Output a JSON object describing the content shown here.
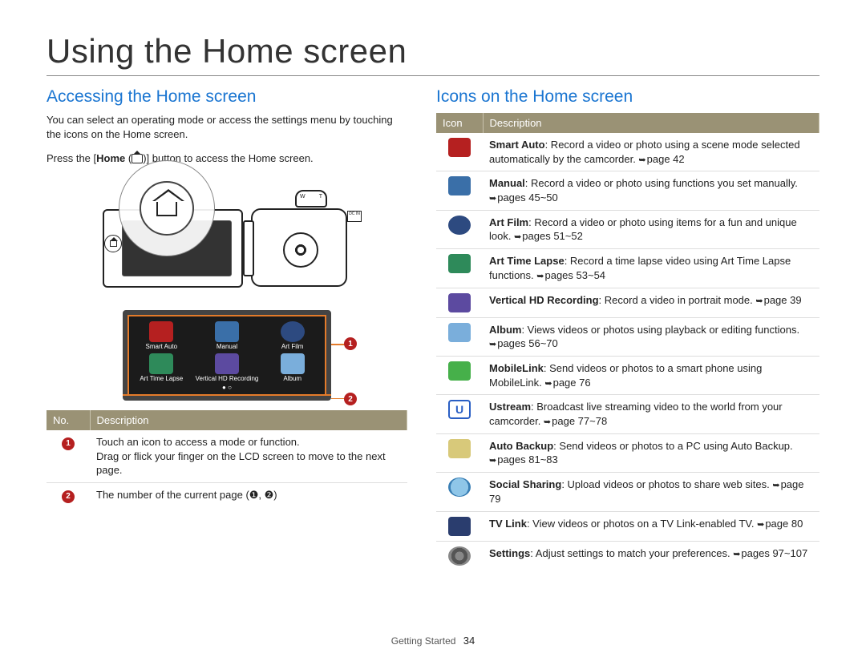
{
  "page_title": "Using the Home screen",
  "footer": {
    "section": "Getting Started",
    "page": "34"
  },
  "left": {
    "heading": "Accessing the Home screen",
    "intro": "You can select an operating mode or access the settings menu by touching the icons on the Home screen.",
    "press_pre": "Press the [",
    "press_home": "Home",
    "press_post": " (      )] button to access the Home screen.",
    "dc_label": "DC IN",
    "zoom_w": "W",
    "zoom_t": "T",
    "hs_icons": [
      {
        "label": "Smart Auto",
        "cls": "smart"
      },
      {
        "label": "Manual",
        "cls": "manual"
      },
      {
        "label": "Art Film",
        "cls": "artfilm"
      },
      {
        "label": "Art Time Lapse",
        "cls": "artlapse"
      },
      {
        "label": "Vertical HD Recording",
        "cls": "vertical"
      },
      {
        "label": "Album",
        "cls": "album"
      }
    ],
    "table": {
      "headers": [
        "No.",
        "Description"
      ],
      "rows": [
        {
          "num": "1",
          "desc": "Touch an icon to access a mode or function.\nDrag or flick your finger on the LCD screen to move to the next page."
        },
        {
          "num": "2",
          "desc": "The number of the current page (❶, ❷)"
        }
      ]
    }
  },
  "right": {
    "heading": "Icons on the Home screen",
    "headers": [
      "Icon",
      "Description"
    ],
    "rows": [
      {
        "icon": "smart",
        "u": "",
        "title": "Smart Auto",
        "body": ": Record a video or photo using a scene mode selected automatically by the camcorder. ",
        "ref": "page 42"
      },
      {
        "icon": "manual",
        "u": "",
        "title": "Manual",
        "body": ": Record a video or photo using functions you set manually. ",
        "ref": "pages 45~50"
      },
      {
        "icon": "artfilm",
        "u": "",
        "title": "Art Film",
        "body": ": Record a video or photo using items for a fun and unique look. ",
        "ref": "pages 51~52"
      },
      {
        "icon": "artlapse",
        "u": "",
        "title": "Art Time Lapse",
        "body": ": Record a time lapse video using Art Time Lapse functions. ",
        "ref": "pages 53~54"
      },
      {
        "icon": "vertical",
        "u": "",
        "title": "Vertical HD Recording",
        "body": ": Record a video in portrait mode. ",
        "ref": "page 39"
      },
      {
        "icon": "album",
        "u": "",
        "title": "Album",
        "body": ": Views videos or photos using playback or editing functions. ",
        "ref": "pages 56~70"
      },
      {
        "icon": "mobilelink",
        "u": "",
        "title": "MobileLink",
        "body": ": Send videos or photos to a smart phone using MobileLink. ",
        "ref": "page 76"
      },
      {
        "icon": "ustream",
        "u": "U",
        "title": "Ustream",
        "body": ": Broadcast live streaming video to the world from your camcorder. ",
        "ref": "page 77~78"
      },
      {
        "icon": "autobackup",
        "u": "",
        "title": "Auto Backup",
        "body": ": Send videos or photos to a PC using Auto Backup. ",
        "ref": "pages 81~83"
      },
      {
        "icon": "socialshare",
        "u": "",
        "title": "Social Sharing",
        "body": ": Upload videos or photos to share web sites. ",
        "ref": "page 79"
      },
      {
        "icon": "tvlink",
        "u": "",
        "title": "TV Link",
        "body": ": View videos or photos on a TV Link-enabled TV. ",
        "ref": "page 80"
      },
      {
        "icon": "settings",
        "u": "",
        "title": "Settings",
        "body": ": Adjust settings to match your preferences. ",
        "ref": "pages 97~107"
      }
    ]
  }
}
